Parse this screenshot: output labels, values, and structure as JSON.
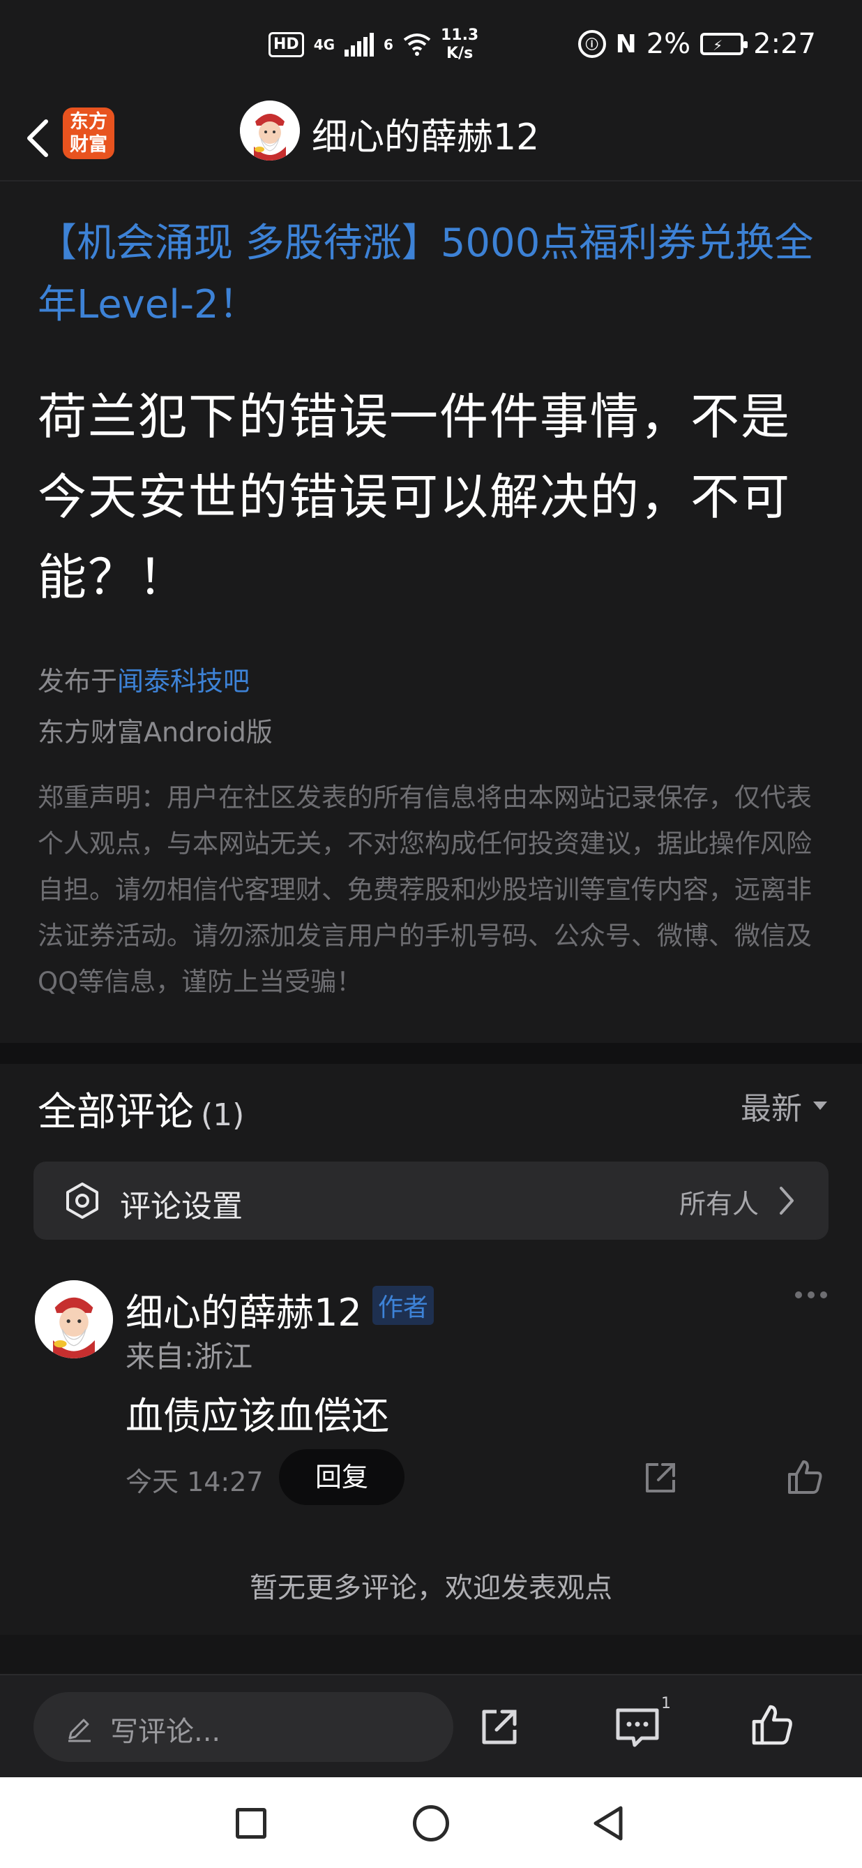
{
  "status_bar": {
    "hd": "HD",
    "signal_label": "4G",
    "wifi_label": "6",
    "net_speed_value": "11.3",
    "net_speed_unit": "K/s",
    "battery_percent": "2%",
    "time": "2:27"
  },
  "nav": {
    "app_logo_line1": "东方",
    "app_logo_line2": "财富",
    "title": "细心的薛赫12"
  },
  "post": {
    "promo": "【机会涌现 多股待涨】5000点福利券兑换全年Level-2！",
    "title": "荷兰犯下的错误一件件事情，不是今天安世的错误可以解决的，不可能？！",
    "published_prefix": "发布于",
    "published_bar": "闻泰科技吧",
    "client": "东方财富Android版",
    "disclaimer": "郑重声明：用户在社区发表的所有信息将由本网站记录保存，仅代表个人观点，与本网站无关，不对您构成任何投资建议，据此操作风险自担。请勿相信代客理财、免费荐股和炒股培训等宣传内容，远离非法证券活动。请勿添加发言用户的手机号码、公众号、微博、微信及QQ等信息，谨防上当受骗！"
  },
  "comments": {
    "header": "全部评论",
    "count": "(1)",
    "sort": "最新",
    "settings_label": "评论设置",
    "settings_value": "所有人",
    "items": [
      {
        "name": "细心的薛赫12",
        "badge": "作者",
        "location": "来自:浙江",
        "text": "血债应该血偿还",
        "time": "今天 14:27",
        "reply_label": "回复"
      }
    ],
    "no_more": "暂无更多评论，欢迎发表观点"
  },
  "bottom_bar": {
    "write_placeholder": "写评论...",
    "comment_count": "1"
  },
  "colors": {
    "background": "#1a1a1b",
    "link_blue": "#3d82d6",
    "brand_orange": "#e8531f"
  }
}
